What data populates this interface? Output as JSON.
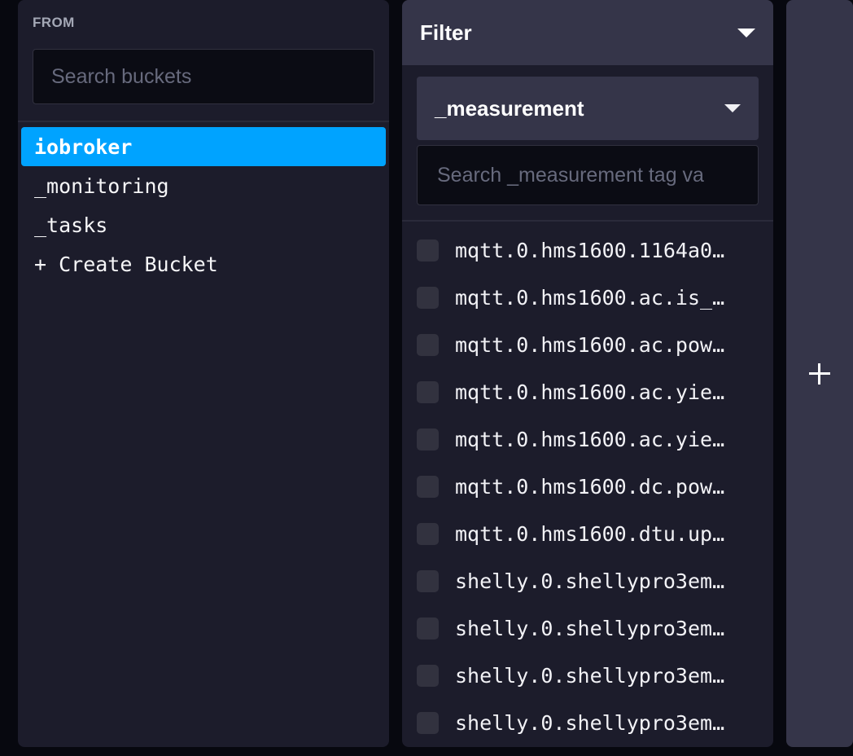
{
  "from_panel": {
    "title": "FROM",
    "search": {
      "placeholder": "Search buckets",
      "value": ""
    },
    "buckets": [
      {
        "label": "iobroker",
        "selected": true
      },
      {
        "label": "_monitoring",
        "selected": false
      },
      {
        "label": "_tasks",
        "selected": false
      }
    ],
    "create_bucket_label": "+ Create Bucket",
    "selected_color": "#00A3FF"
  },
  "filter_panel": {
    "header_title": "Filter",
    "header_caret_icon": "caret-down-icon",
    "tag_key_dropdown": {
      "value": "_measurement",
      "caret_icon": "caret-down-icon"
    },
    "tag_value_search": {
      "placeholder": "Search _measurement tag va",
      "value": ""
    },
    "measurements": [
      {
        "label": "mqtt.0.hms1600.1164a0…",
        "checked": false
      },
      {
        "label": "mqtt.0.hms1600.ac.is_…",
        "checked": false
      },
      {
        "label": "mqtt.0.hms1600.ac.pow…",
        "checked": false
      },
      {
        "label": "mqtt.0.hms1600.ac.yie…",
        "checked": false
      },
      {
        "label": "mqtt.0.hms1600.ac.yie…",
        "checked": false
      },
      {
        "label": "mqtt.0.hms1600.dc.pow…",
        "checked": false
      },
      {
        "label": "mqtt.0.hms1600.dtu.up…",
        "checked": false
      },
      {
        "label": "shelly.0.shellypro3em…",
        "checked": false
      },
      {
        "label": "shelly.0.shellypro3em…",
        "checked": false
      },
      {
        "label": "shelly.0.shellypro3em…",
        "checked": false
      },
      {
        "label": "shelly.0.shellypro3em…",
        "checked": false
      }
    ]
  },
  "add_panel": {
    "plus_icon": "plus-icon"
  }
}
